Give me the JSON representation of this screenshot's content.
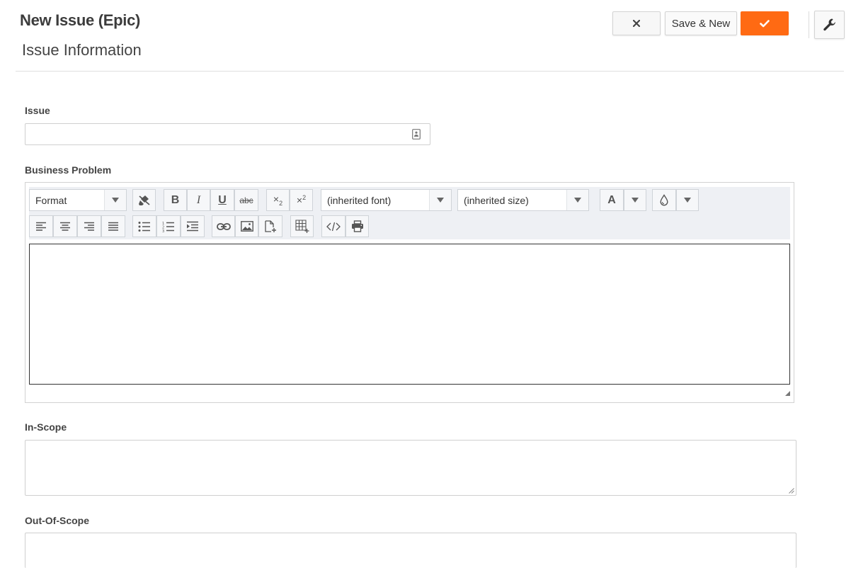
{
  "header": {
    "page_title": "New Issue (Epic)",
    "section_title": "Issue Information",
    "save_new_label": "Save & New",
    "accent_color": "#ff6a13"
  },
  "fields": {
    "issue": {
      "label": "Issue",
      "value": ""
    },
    "business_problem": {
      "label": "Business Problem"
    },
    "in_scope": {
      "label": "In-Scope"
    },
    "out_of_scope": {
      "label": "Out-Of-Scope"
    }
  },
  "editor": {
    "format_label": "Format",
    "font_label": "(inherited font)",
    "size_label": "(inherited size)",
    "toolbar_icons": [
      "remove-format-icon",
      "bold-icon",
      "italic-icon",
      "underline-icon",
      "strikethrough-icon",
      "subscript-icon",
      "superscript-icon",
      "font-color-icon",
      "background-color-icon",
      "align-left-icon",
      "align-center-icon",
      "align-right-icon",
      "justify-icon",
      "bulleted-list-icon",
      "numbered-list-icon",
      "indent-icon",
      "link-icon",
      "image-icon",
      "insert-file-icon",
      "table-icon",
      "source-code-icon",
      "print-icon"
    ]
  }
}
